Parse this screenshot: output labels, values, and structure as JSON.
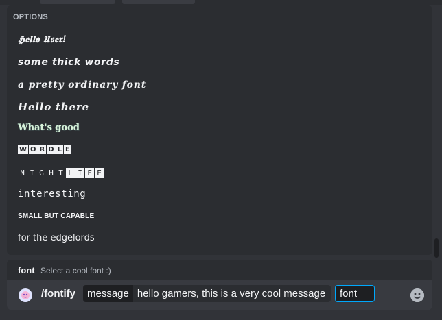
{
  "options": {
    "header": "OPTIONS",
    "items": [
      {
        "label": "𝕳𝖊𝖑𝖑𝖔 𝖀𝖘𝖊𝖗!"
      },
      {
        "label": "some thick words"
      },
      {
        "label": "a pretty ordinary font"
      },
      {
        "label": "Hello there"
      },
      {
        "label": "What's good"
      },
      {
        "label": [
          "W",
          "O",
          "R",
          "D",
          "L",
          "E"
        ]
      },
      {
        "label": [
          "N",
          "I",
          "G",
          "H",
          "T",
          "L",
          "I",
          "F",
          "E"
        ]
      },
      {
        "label": "interesting"
      },
      {
        "label": "SMALL BUT CAPABLE"
      },
      {
        "label": "for the edgelords"
      }
    ]
  },
  "hint": {
    "param": "font",
    "description": "Select a cool font :)"
  },
  "input": {
    "command": "/fontify",
    "param1_name": "message",
    "param1_value": "hello gamers, this is a very cool message",
    "param2_name": "font"
  },
  "colors": {
    "background": "#313338",
    "panel": "#2b2d31",
    "input": "#383a40",
    "focus": "#00a8fc"
  },
  "icons": {
    "app": "bot-avatar-icon",
    "emoji": "emoji-picker-icon"
  }
}
